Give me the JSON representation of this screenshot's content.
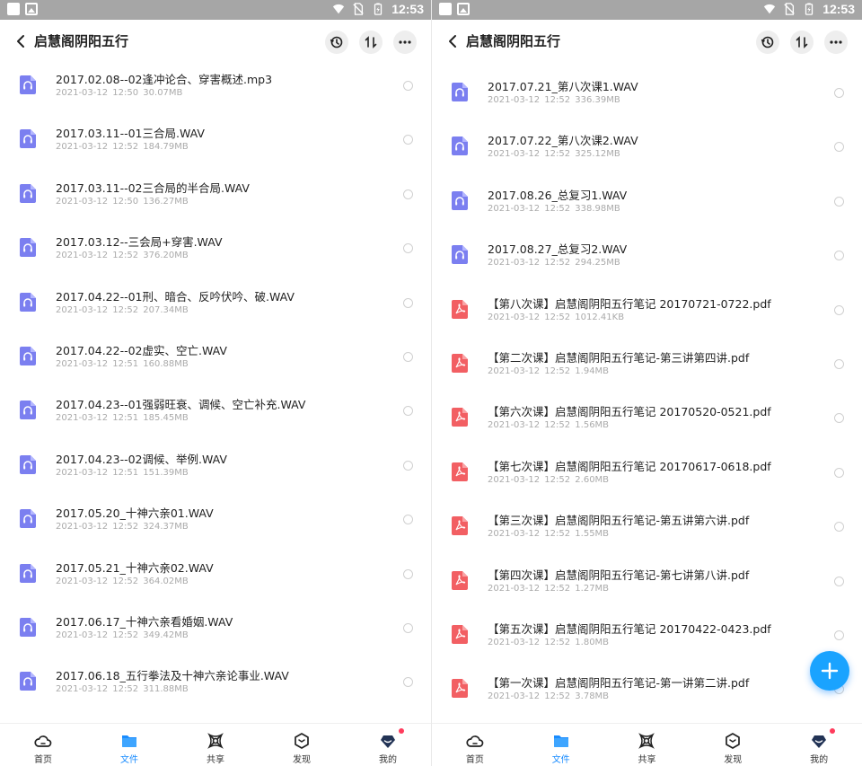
{
  "status": {
    "time": "12:53"
  },
  "colors": {
    "accent": "#1a8cff",
    "audio_icon": "#7b7ff0",
    "pdf_icon": "#f25f63",
    "badge": "#ff3b5c"
  },
  "left": {
    "title": "启慧阁阴阳五行",
    "files": [
      {
        "type": "audio",
        "name": "2017.02.08--02逢冲论合、穿害概述.mp3",
        "meta": "2021-03-12  12:50  30.07MB"
      },
      {
        "type": "audio",
        "name": "2017.03.11--01三合局.WAV",
        "meta": "2021-03-12  12:52  184.79MB"
      },
      {
        "type": "audio",
        "name": "2017.03.11--02三合局的半合局.WAV",
        "meta": "2021-03-12  12:50  136.27MB"
      },
      {
        "type": "audio",
        "name": "2017.03.12--三会局+穿害.WAV",
        "meta": "2021-03-12  12:52  376.20MB"
      },
      {
        "type": "audio",
        "name": "2017.04.22--01刑、暗合、反吟伏吟、破.WAV",
        "meta": "2021-03-12  12:52  207.34MB"
      },
      {
        "type": "audio",
        "name": "2017.04.22--02虚实、空亡.WAV",
        "meta": "2021-03-12  12:51  160.88MB"
      },
      {
        "type": "audio",
        "name": "2017.04.23--01强弱旺衰、调候、空亡补充.WAV",
        "meta": "2021-03-12  12:51  185.45MB"
      },
      {
        "type": "audio",
        "name": "2017.04.23--02调候、举例.WAV",
        "meta": "2021-03-12  12:51  151.39MB"
      },
      {
        "type": "audio",
        "name": "2017.05.20_十神六亲01.WAV",
        "meta": "2021-03-12  12:52  324.37MB"
      },
      {
        "type": "audio",
        "name": "2017.05.21_十神六亲02.WAV",
        "meta": "2021-03-12  12:52  364.02MB"
      },
      {
        "type": "audio",
        "name": "2017.06.17_十神六亲看婚姻.WAV",
        "meta": "2021-03-12  12:52  349.42MB"
      },
      {
        "type": "audio",
        "name": "2017.06.18_五行拳法及十神六亲论事业.WAV",
        "meta": "2021-03-12  12:52  311.88MB"
      },
      {
        "type": "audio",
        "name": "2017.07.21_第八次课1.WAV",
        "meta": "2021-03-12  12:52  336.39MB"
      }
    ]
  },
  "right": {
    "title": "启慧阁阴阳五行",
    "files": [
      {
        "type": "audio",
        "name": "2017.07.21_第八次课1.WAV",
        "meta": "2021-03-12  12:52  336.39MB"
      },
      {
        "type": "audio",
        "name": "2017.07.22_第八次课2.WAV",
        "meta": "2021-03-12  12:52  325.12MB"
      },
      {
        "type": "audio",
        "name": "2017.08.26_总复习1.WAV",
        "meta": "2021-03-12  12:52  338.98MB"
      },
      {
        "type": "audio",
        "name": "2017.08.27_总复习2.WAV",
        "meta": "2021-03-12  12:52  294.25MB"
      },
      {
        "type": "pdf",
        "name": "【第八次课】启慧阁阴阳五行笔记 20170721-0722.pdf",
        "meta": "2021-03-12  12:52  1012.41KB"
      },
      {
        "type": "pdf",
        "name": "【第二次课】启慧阁阴阳五行笔记-第三讲第四讲.pdf",
        "meta": "2021-03-12  12:52  1.94MB"
      },
      {
        "type": "pdf",
        "name": "【第六次课】启慧阁阴阳五行笔记 20170520-0521.pdf",
        "meta": "2021-03-12  12:52  1.56MB"
      },
      {
        "type": "pdf",
        "name": "【第七次课】启慧阁阴阳五行笔记 20170617-0618.pdf",
        "meta": "2021-03-12  12:52  2.60MB"
      },
      {
        "type": "pdf",
        "name": "【第三次课】启慧阁阴阳五行笔记-第五讲第六讲.pdf",
        "meta": "2021-03-12  12:52  1.55MB"
      },
      {
        "type": "pdf",
        "name": "【第四次课】启慧阁阴阳五行笔记-第七讲第八讲.pdf",
        "meta": "2021-03-12  12:52  1.27MB"
      },
      {
        "type": "pdf",
        "name": "【第五次课】启慧阁阴阳五行笔记 20170422-0423.pdf",
        "meta": "2021-03-12  12:52  1.80MB"
      },
      {
        "type": "pdf",
        "name": "【第一次课】启慧阁阴阳五行笔记-第一讲第二讲.pdf",
        "meta": "2021-03-12  12:52  3.78MB"
      }
    ]
  },
  "tabs": [
    {
      "label": "首页",
      "icon": "cloud-icon"
    },
    {
      "label": "文件",
      "icon": "folder-icon"
    },
    {
      "label": "共享",
      "icon": "share-icon"
    },
    {
      "label": "发现",
      "icon": "discover-icon"
    },
    {
      "label": "我的",
      "icon": "profile-icon"
    }
  ]
}
